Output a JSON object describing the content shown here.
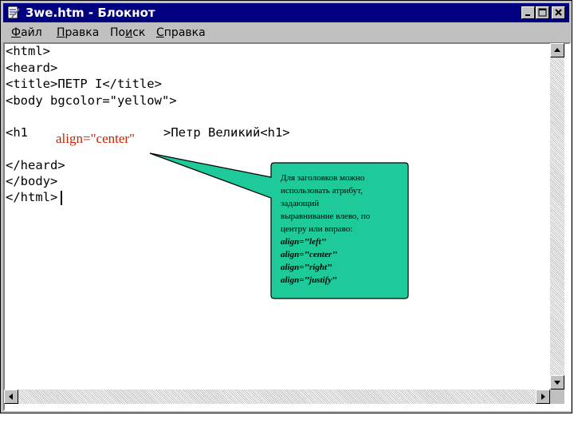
{
  "window": {
    "title": "3we.htm - Блокнот"
  },
  "menu": {
    "items": [
      {
        "underline": "Ф",
        "rest": "айл"
      },
      {
        "underline": "П",
        "rest": "равка"
      },
      {
        "pre": "По",
        "underline": "и",
        "rest": "ск"
      },
      {
        "underline": "С",
        "rest": "правка"
      }
    ]
  },
  "code_lines": [
    "<html>",
    "<heard>",
    "<title>ПЕТР I</title>",
    "<body bgcolor=\"yellow\">",
    "<h1",
    ">Петр Великий<h1>",
    "</heard>",
    "</body>",
    "</html>"
  ],
  "overlay": {
    "align_label": "align=\"center\""
  },
  "callout": {
    "text_lines": [
      "Для заголовков можно",
      "использовать атрибут,",
      "задающий",
      "выравнивание влево, по",
      "центру или вправо:"
    ],
    "examples": [
      "align=’’left’’",
      "align=’’center’’",
      "align=’’right’’",
      "align=’’justify’’"
    ],
    "fill_color": "#1ec99a"
  }
}
